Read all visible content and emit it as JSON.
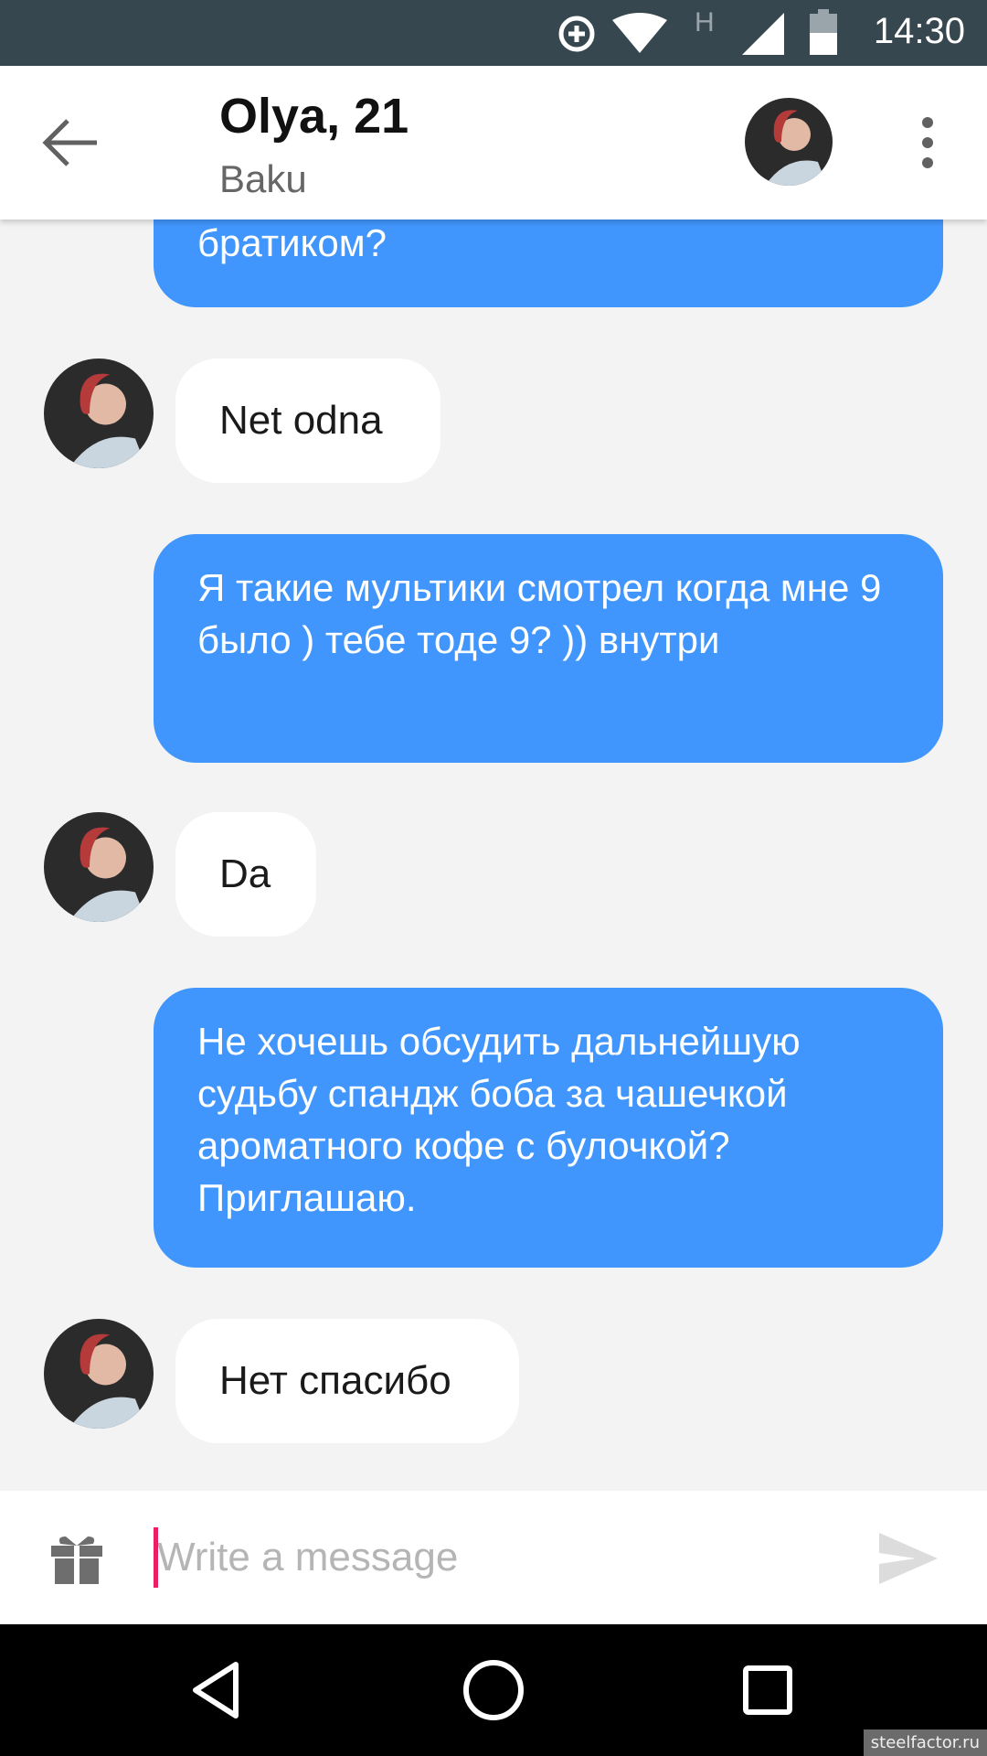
{
  "status_bar": {
    "time": "14:30",
    "network_letter": "H",
    "icons": [
      "data-saver-icon",
      "wifi-icon",
      "cellular-signal-icon",
      "battery-icon"
    ]
  },
  "header": {
    "name": "Olya, 21",
    "city": "Baku",
    "icons": [
      "back-arrow-icon",
      "more-vert-icon"
    ]
  },
  "messages": [
    {
      "direction": "outgoing",
      "text": "братиком?"
    },
    {
      "direction": "incoming",
      "text": "Net odna"
    },
    {
      "direction": "outgoing",
      "text": "Я такие мультики смотрел когда мне 9 было ) тебе тоде 9? )) внутри"
    },
    {
      "direction": "incoming",
      "text": "Da"
    },
    {
      "direction": "outgoing",
      "text": "Не хочешь обсудить дальнейшую судьбу спандж боба за чашечкой ароматного кофе с булочкой? Приглашаю."
    },
    {
      "direction": "incoming",
      "text": "Нет спасибо"
    }
  ],
  "composer": {
    "placeholder": "Write a message",
    "value": "",
    "icons": [
      "gift-icon",
      "send-icon"
    ]
  },
  "nav_bar": {
    "icons": [
      "nav-back-icon",
      "nav-home-icon",
      "nav-recents-icon"
    ]
  },
  "watermark": "steelfactor.ru",
  "colors": {
    "status_bar": "#37474f",
    "outgoing_bubble": "#4196fd",
    "incoming_bubble": "#ffffff",
    "chat_background": "#f3f3f3",
    "cursor": "#e91e63"
  }
}
